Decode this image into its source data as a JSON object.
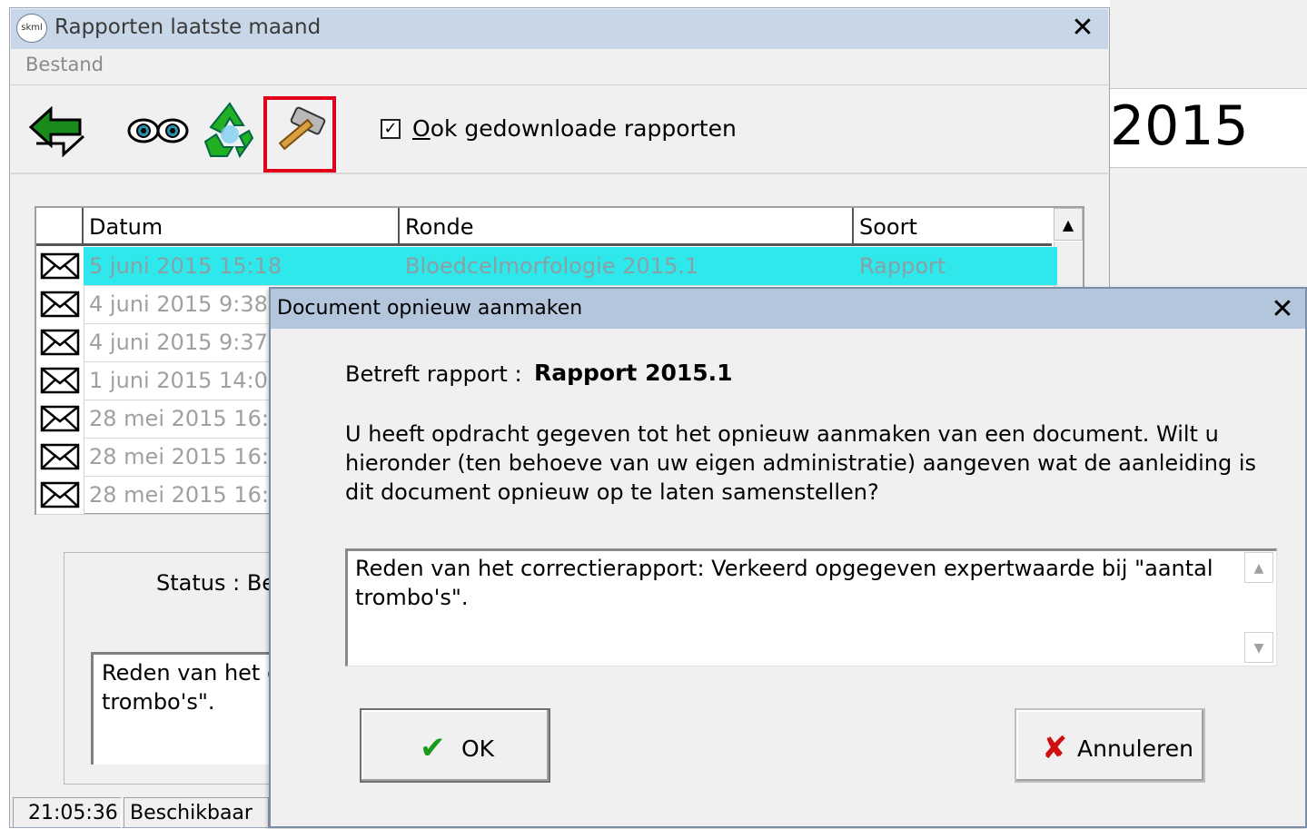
{
  "background_window": {
    "year_text": "2015"
  },
  "main_window": {
    "app_icon_text": "skml",
    "title": "Rapporten laatste maand",
    "close_glyph": "✕",
    "menu": {
      "bestand": "Bestand"
    },
    "toolbar": {
      "icons": [
        "back-arrow-icon",
        "eyes-icon",
        "recycle-icon",
        "hammer-icon"
      ],
      "checkbox_checked": true,
      "checkbox_label_accel": "O",
      "checkbox_label_rest": "ok gedownloade rapporten"
    },
    "grid": {
      "columns": [
        "Datum",
        "Ronde",
        "Soort"
      ],
      "rows": [
        {
          "datum": "5 juni 2015  15:18",
          "ronde": "Bloedcelmorfologie 2015.1",
          "soort": "Rapport",
          "selected": true
        },
        {
          "datum": "4 juni 2015  9:38",
          "ronde": "",
          "soort": ""
        },
        {
          "datum": "4 juni 2015  9:37",
          "ronde": "",
          "soort": ""
        },
        {
          "datum": "1 juni 2015  14:0",
          "ronde": "",
          "soort": ""
        },
        {
          "datum": "28 mei 2015  16:",
          "ronde": "",
          "soort": ""
        },
        {
          "datum": "28 mei 2015  16:",
          "ronde": "",
          "soort": ""
        },
        {
          "datum": "28 mei 2015  16:",
          "ronde": "",
          "soort": ""
        }
      ],
      "scroll_up_glyph": "▲"
    },
    "status": {
      "label": "Status : Be",
      "text": "Reden van het c\ntrombo's\"."
    },
    "statusbar": {
      "time": "21:05:36",
      "state": "Beschikbaar"
    }
  },
  "dialog": {
    "title": "Document opnieuw aanmaken",
    "close_glyph": "✕",
    "betreft_label": "Betreft rapport :",
    "betreft_value": "Rapport 2015.1",
    "message": "U heeft opdracht gegeven tot het opnieuw aanmaken van een document. Wilt u hieronder (ten behoeve van uw eigen administratie) aangeven wat de aanleiding is dit document opnieuw op te laten samenstellen?",
    "reason_text": "Reden van het correctierapport: Verkeerd opgegeven expertwaarde bij \"aantal\ntrombo's\".",
    "scroll_up_glyph": "▲",
    "scroll_down_glyph": "▼",
    "ok_label": "OK",
    "ok_glyph": "✔",
    "cancel_label": "Annuleren",
    "cancel_glyph": "✘"
  }
}
